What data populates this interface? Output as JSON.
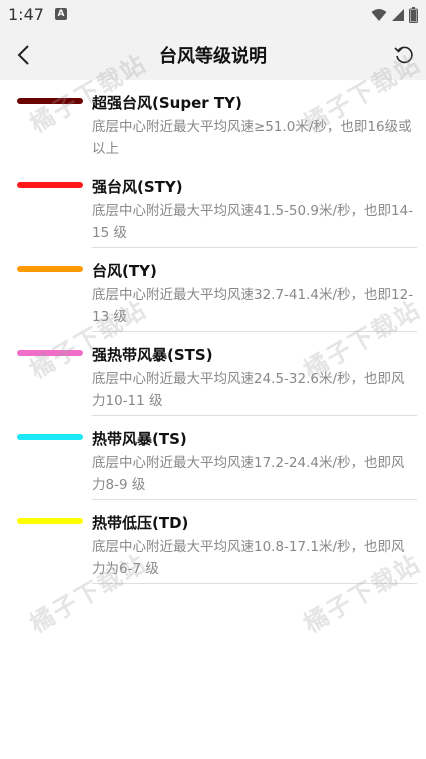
{
  "status_bar": {
    "time": "1:47",
    "notification_glyph": "A",
    "icons": [
      "wifi-icon",
      "signal-icon",
      "battery-icon"
    ]
  },
  "header": {
    "title": "台风等级说明",
    "back_icon": "chevron-left-icon",
    "refresh_icon": "refresh-icon"
  },
  "levels": [
    {
      "title": "超强台风(Super TY)",
      "desc": "底层中心附近最大平均风速≥51.0米/秒，也即16级或以上",
      "color": "#6b0000"
    },
    {
      "title": "强台风(STY)",
      "desc": "底层中心附近最大平均风速41.5-50.9米/秒，也即14-15 级",
      "color": "#ff1a1a"
    },
    {
      "title": "台风(TY)",
      "desc": "底层中心附近最大平均风速32.7-41.4米/秒，也即12-13 级",
      "color": "#ff9900"
    },
    {
      "title": "强热带风暴(STS)",
      "desc": "底层中心附近最大平均风速24.5-32.6米/秒，也即风力10-11 级",
      "color": "#f06ec8"
    },
    {
      "title": "热带风暴(TS)",
      "desc": "底层中心附近最大平均风速17.2-24.4米/秒，也即风力8-9 级",
      "color": "#1de9f6"
    },
    {
      "title": "热带低压(TD)",
      "desc": "底层中心附近最大平均风速10.8-17.1米/秒，也即风力为6-7 级",
      "color": "#ffff00"
    }
  ],
  "watermark_text": "橘子下载站"
}
